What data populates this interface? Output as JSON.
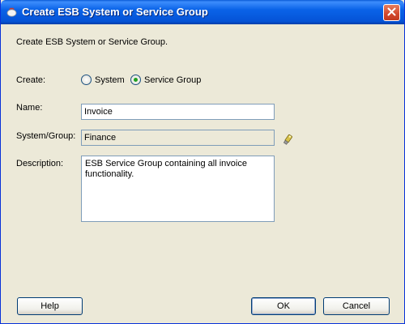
{
  "window": {
    "title": "Create ESB System or Service Group"
  },
  "intro_text": "Create ESB System or Service Group.",
  "create": {
    "label": "Create:",
    "options": [
      {
        "label": "System",
        "selected": false
      },
      {
        "label": "Service Group",
        "selected": true
      }
    ]
  },
  "name": {
    "label": "Name:",
    "value": "Invoice"
  },
  "system_group": {
    "label": "System/Group:",
    "value": "Finance",
    "browse_icon": "flashlight-icon"
  },
  "description": {
    "label": "Description:",
    "value": "ESB Service Group containing all invoice\nfunctionality."
  },
  "buttons": {
    "help": "Help",
    "ok": "OK",
    "cancel": "Cancel"
  },
  "colors": {
    "titlebar": "#0553d6",
    "dialog_bg": "#ece9d8",
    "field_border": "#7f9db9"
  }
}
